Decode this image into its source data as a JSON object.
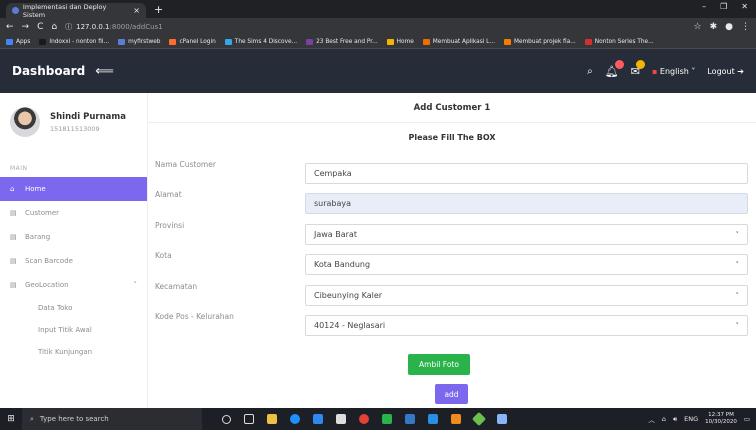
{
  "browser": {
    "tab_title": "Implementasi dan Deploy Sistem",
    "url_host": "127.0.0.1",
    "url_path": ":8000/addCus1",
    "bookmarks": [
      {
        "label": "Apps",
        "color": "#4285f4"
      },
      {
        "label": "Indoxxi - nonton fil...",
        "color": "#1a1a1a"
      },
      {
        "label": "myfirstweb",
        "color": "#5b7bd5"
      },
      {
        "label": "cPanel Login",
        "color": "#ff6c2c"
      },
      {
        "label": "The Sims 4 Discove...",
        "color": "#35a6e8"
      },
      {
        "label": "23 Best Free and Pr...",
        "color": "#7b3fa0"
      },
      {
        "label": "Home",
        "color": "#f5b400"
      },
      {
        "label": "Membuat Aplikasi L...",
        "color": "#ef6c00"
      },
      {
        "label": "Membuat projek fla...",
        "color": "#f57c00"
      },
      {
        "label": "Nonton Series The...",
        "color": "#d32f2f"
      }
    ]
  },
  "header": {
    "brand": "Dashboard",
    "language": "English",
    "logout": "Logout"
  },
  "sidebar": {
    "user_name": "Shindi Purnama",
    "user_id": "151811513009",
    "section": "MAIN",
    "items": [
      {
        "label": "Home",
        "active": true
      },
      {
        "label": "Customer",
        "active": false
      },
      {
        "label": "Barang",
        "active": false
      },
      {
        "label": "Scan Barcode",
        "active": false
      },
      {
        "label": "GeoLocation",
        "active": false
      }
    ],
    "sub_items": [
      "Data Toko",
      "Input Titik Awal",
      "Titik Kunjungan"
    ]
  },
  "main": {
    "title": "Add Customer 1",
    "subtitle": "Please Fill The BOX",
    "fields": [
      {
        "label": "Nama Customer",
        "value": "Cempaka",
        "type": "text"
      },
      {
        "label": "Alamat",
        "value": "surabaya",
        "type": "text"
      },
      {
        "label": "Provinsi",
        "value": "Jawa Barat",
        "type": "select"
      },
      {
        "label": "Kota",
        "value": "Kota Bandung",
        "type": "select"
      },
      {
        "label": "Kecamatan",
        "value": "Cibeunying Kaler",
        "type": "select"
      },
      {
        "label": "Kode Pos - Kelurahan",
        "value": "40124 - Neglasari",
        "type": "select"
      }
    ],
    "photo_button": "Ambil Foto",
    "add_button": "add"
  },
  "taskbar": {
    "search_placeholder": "Type here to search",
    "lang": "ENG",
    "time": "12:37 PM",
    "date": "10/30/2020"
  },
  "colors": {
    "accent": "#7b68ee",
    "photo_button": "#2bb34b",
    "header_bg": "#262d38"
  }
}
